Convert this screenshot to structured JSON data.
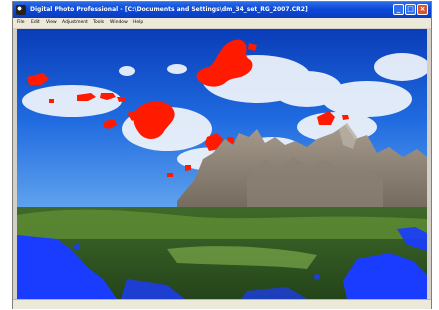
{
  "window": {
    "title": "Digital Photo Professional - [C:\\Documents and Settings\\dm_34_set_RG_2007.CR2]",
    "controls": {
      "minimize": "_",
      "maximize": "□",
      "close": "×"
    }
  },
  "menu": {
    "items": [
      {
        "label": "File"
      },
      {
        "label": "Edit"
      },
      {
        "label": "View"
      },
      {
        "label": "Adjustment"
      },
      {
        "label": "Tools"
      },
      {
        "label": "Window"
      },
      {
        "label": "Help"
      }
    ]
  },
  "image": {
    "subject": "mountain-landscape-with-clipping-highlight-overlay",
    "highlight_warning_color": "#ff1a00",
    "shadow_warning_color": "#1a3cff"
  },
  "status": {
    "text": ""
  }
}
